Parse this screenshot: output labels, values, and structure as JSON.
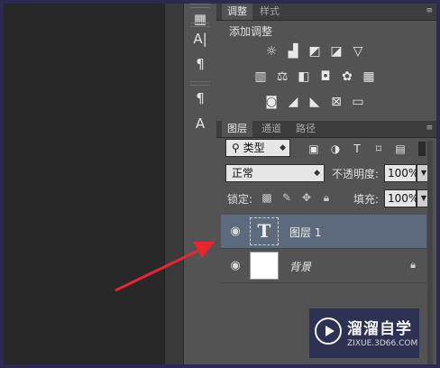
{
  "toolstrip": {
    "items": [
      {
        "icon": "character-panel-icon",
        "glyph": "A|"
      },
      {
        "icon": "paragraph-panel-icon",
        "glyph": "¶"
      },
      {
        "icon": "paragraph-styles-icon",
        "glyph": "¶"
      },
      {
        "icon": "character-styles-icon",
        "glyph": "A"
      }
    ]
  },
  "adjustments_panel": {
    "tabs": [
      "调整",
      "样式"
    ],
    "title": "添加调整"
  },
  "layers_panel": {
    "tabs": [
      "图层",
      "通道",
      "路径"
    ],
    "filter_kind": "类型",
    "blend_mode": "正常",
    "opacity_label": "不透明度:",
    "opacity_value": "100%",
    "lock_label": "锁定:",
    "fill_label": "填充:",
    "fill_value": "100%",
    "layers": [
      {
        "name": "图层 1",
        "type": "text",
        "thumb_glyph": "T",
        "selected": true
      },
      {
        "name": "背景",
        "type": "background",
        "locked": true
      }
    ]
  },
  "watermark": {
    "title": "溜溜自学",
    "url": "ZIXUE.3D66.COM"
  },
  "colors": {
    "selected_layer": "#5d6a7d",
    "annotation_arrow": "#e8262c",
    "panel_bg": "#535353"
  }
}
